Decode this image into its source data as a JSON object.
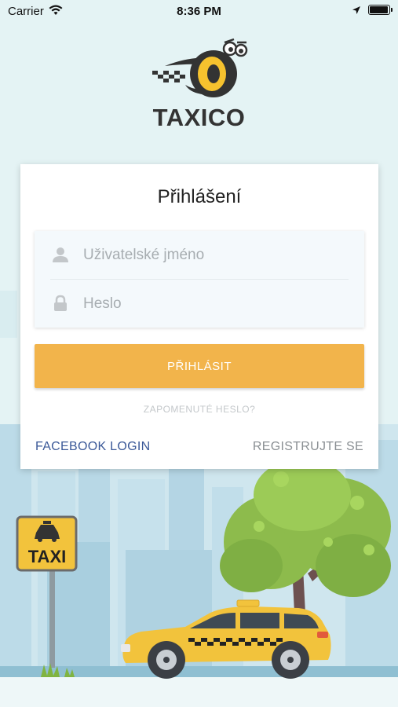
{
  "status_bar": {
    "carrier": "Carrier",
    "time": "8:36 PM"
  },
  "brand": {
    "name": "TAXICO"
  },
  "login": {
    "title": "Přihlášení",
    "username_placeholder": "Uživatelské jméno",
    "password_placeholder": "Heslo",
    "submit_label": "PŘIHLÁSIT",
    "forgot_label": "ZAPOMENUTÉ HESLO?",
    "facebook_label": "FACEBOOK LOGIN",
    "register_label": "REGISTRUJTE SE"
  },
  "scene": {
    "sign_text": "TAXI"
  },
  "colors": {
    "accent": "#f2b44b",
    "facebook": "#3b5998",
    "background": "#e4f3f4"
  },
  "icons": [
    "wifi-icon",
    "location-arrow-icon",
    "battery-icon",
    "user-icon",
    "lock-icon"
  ]
}
